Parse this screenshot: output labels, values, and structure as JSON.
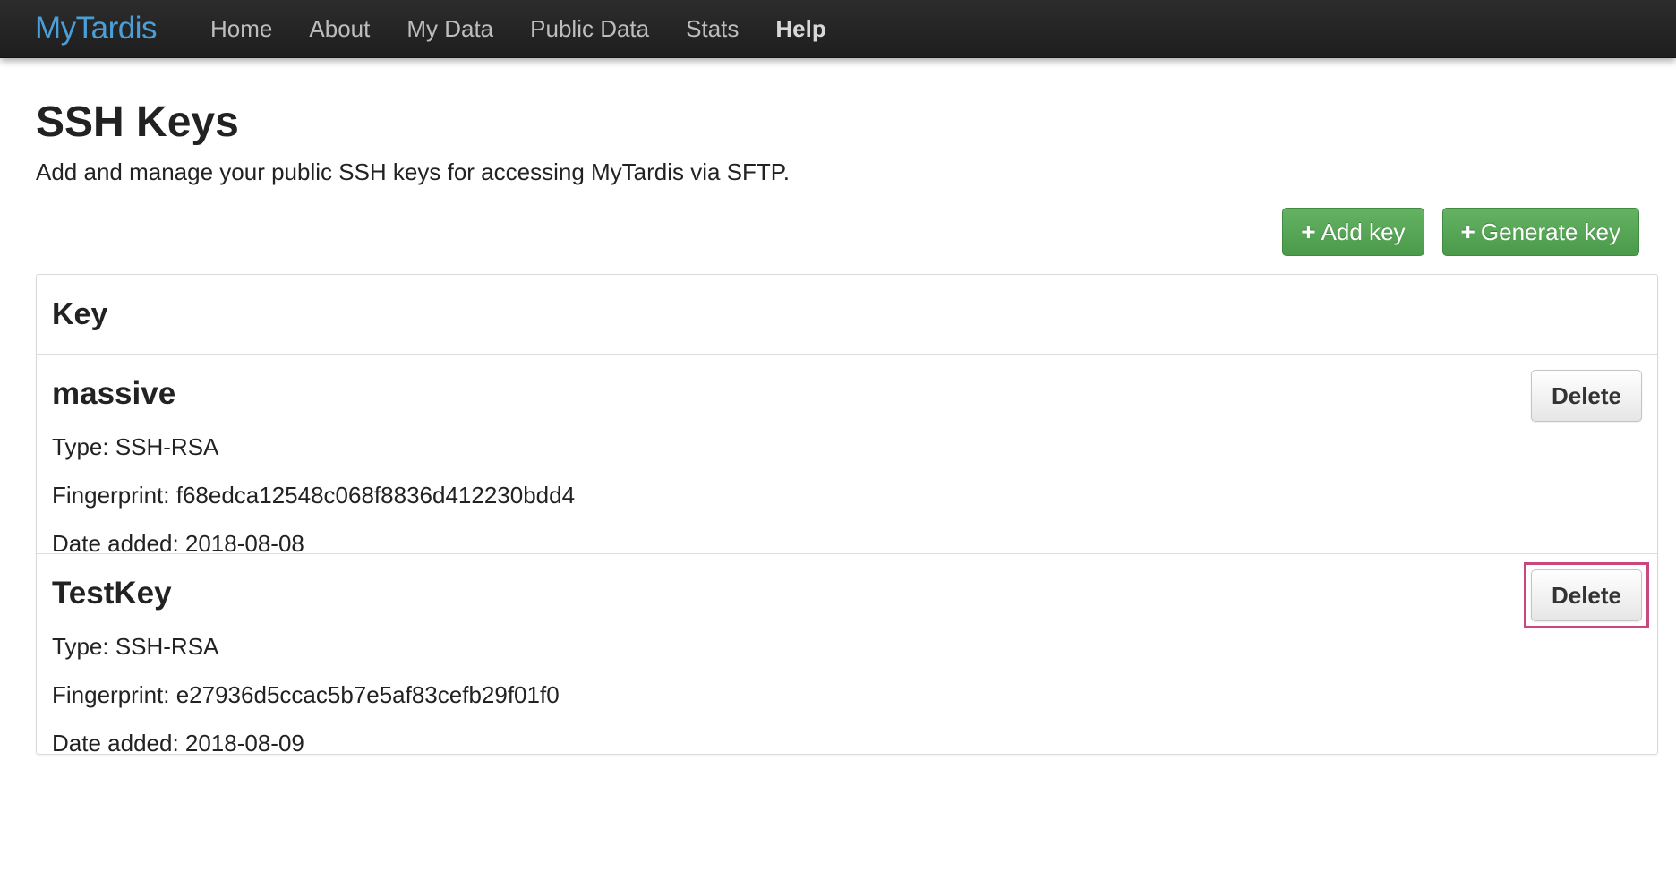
{
  "navbar": {
    "brand": "MyTardis",
    "items": [
      "Home",
      "About",
      "My Data",
      "Public Data",
      "Stats",
      "Help"
    ]
  },
  "page": {
    "title": "SSH Keys",
    "subtitle": "Add and manage your public SSH keys for accessing MyTardis via SFTP."
  },
  "actions": {
    "add_key": "Add key",
    "generate_key": "Generate key",
    "plus_icon": "+"
  },
  "table": {
    "header": "Key",
    "rows": [
      {
        "name": "massive",
        "type": "Type: SSH-RSA",
        "fingerprint": "Fingerprint: f68edca12548c068f8836d412230bdd4",
        "date_added": "Date added: 2018-08-08",
        "delete_label": "Delete"
      },
      {
        "name": "TestKey",
        "type": "Type: SSH-RSA",
        "fingerprint": "Fingerprint: e27936d5ccac5b7e5af83cefb29f01f0",
        "date_added": "Date added: 2018-08-09",
        "delete_label": "Delete"
      }
    ]
  },
  "colors": {
    "brand": "#4a9fd8",
    "success": "#5cb85c",
    "highlight": "#c8477f"
  }
}
